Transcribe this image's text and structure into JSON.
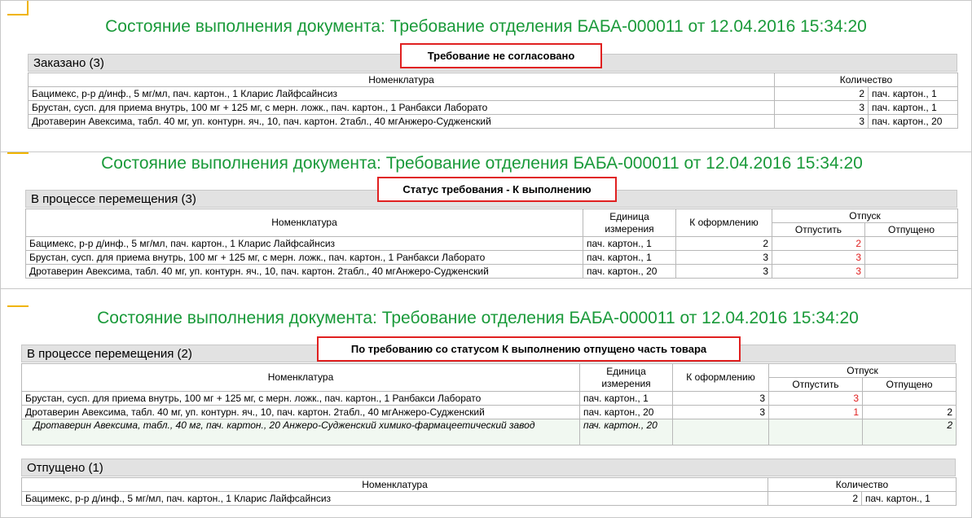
{
  "panel1": {
    "title": "Состояние выполнения документа: Требование отделения БАБА-000011 от 12.04.2016 15:34:20",
    "callout": "Требование не согласовано",
    "section": "Заказано (3)",
    "headers": [
      "Номенклатура",
      "Количество"
    ],
    "rows": [
      {
        "name": "Бацимекс, р-р д/инф., 5 мг/мл, пач. картон., 1  Кларис Лайфсайнсиз",
        "qty": "2",
        "unit": "пач. картон., 1"
      },
      {
        "name": "Брустан, сусп. для приема внутрь, 100 мг + 125 мг, с мерн. ложк., пач. картон., 1  Ранбакси Лаборато",
        "qty": "3",
        "unit": "пач. картон., 1"
      },
      {
        "name": "Дротаверин Авексима, табл. 40 мг, уп. контурн. яч., 10, пач. картон. 2табл., 40 мгАнжеро-Судженский",
        "qty": "3",
        "unit": "пач. картон., 20"
      }
    ]
  },
  "panel2": {
    "title": "Состояние выполнения документа: Требование отделения БАБА-000011 от 12.04.2016 15:34:20",
    "callout": "Статус требования - К выполнению",
    "section": "В процессе перемещения (3)",
    "headers": {
      "name": "Номенклатура",
      "unit": "Единица измерения",
      "to_process": "К оформлению",
      "release": "Отпуск",
      "to_release": "Отпустить",
      "released": "Отпущено"
    },
    "rows": [
      {
        "name": "Бацимекс, р-р д/инф., 5 мг/мл, пач. картон., 1  Кларис Лайфсайнсиз",
        "unit": "пач. картон., 1",
        "to_process": "2",
        "to_release": "2",
        "released": ""
      },
      {
        "name": "Брустан, сусп. для приема внутрь, 100 мг + 125 мг, с мерн. ложк., пач. картон., 1  Ранбакси Лаборато",
        "unit": "пач. картон., 1",
        "to_process": "3",
        "to_release": "3",
        "released": ""
      },
      {
        "name": "Дротаверин Авексима, табл. 40 мг, уп. контурн. яч., 10, пач. картон. 2табл., 40 мгАнжеро-Судженский",
        "unit": "пач. картон., 20",
        "to_process": "3",
        "to_release": "3",
        "released": ""
      }
    ]
  },
  "panel3": {
    "title": "Состояние выполнения документа: Требование отделения БАБА-000011 от 12.04.2016 15:34:20",
    "callout": "По требованию со статусом К выполнению отпущено часть  товара",
    "section": "В процессе перемещения (2)",
    "headers": {
      "name": "Номенклатура",
      "unit": "Единица измерения",
      "to_process": "К оформлению",
      "release": "Отпуск",
      "to_release": "Отпустить",
      "released": "Отпущено"
    },
    "rows": [
      {
        "name": "Брустан, сусп. для приема внутрь, 100 мг + 125 мг, с мерн. ложк., пач. картон., 1  Ранбакси Лаборато",
        "unit": "пач. картон., 1",
        "to_process": "3",
        "to_release": "3",
        "released": ""
      },
      {
        "name": "Дротаверин Авексима, табл. 40 мг, уп. контурн. яч., 10, пач. картон. 2табл., 40 мгАнжеро-Судженский",
        "unit": "пач. картон., 20",
        "to_process": "3",
        "to_release": "1",
        "released": "2"
      }
    ],
    "subrow": {
      "name": "Дротаверин Авексима, табл., 40 мг, пач. картон., 20  Анжеро-Судженский химико-фармацеетический завод",
      "unit": "пач. картон., 20",
      "released": "2"
    },
    "released_section": "Отпущено (1)",
    "released_headers": [
      "Номенклатура",
      "Количество"
    ],
    "released_rows": [
      {
        "name": "Бацимекс, р-р д/инф., 5 мг/мл, пач. картон., 1  Кларис Лайфсайнсиз",
        "qty": "2",
        "unit": "пач. картон., 1"
      }
    ]
  },
  "colors": {
    "title": "#1a9a3a",
    "callout_border": "#e02020",
    "red_value": "#e02020",
    "corner_marker": "#f0b400"
  }
}
